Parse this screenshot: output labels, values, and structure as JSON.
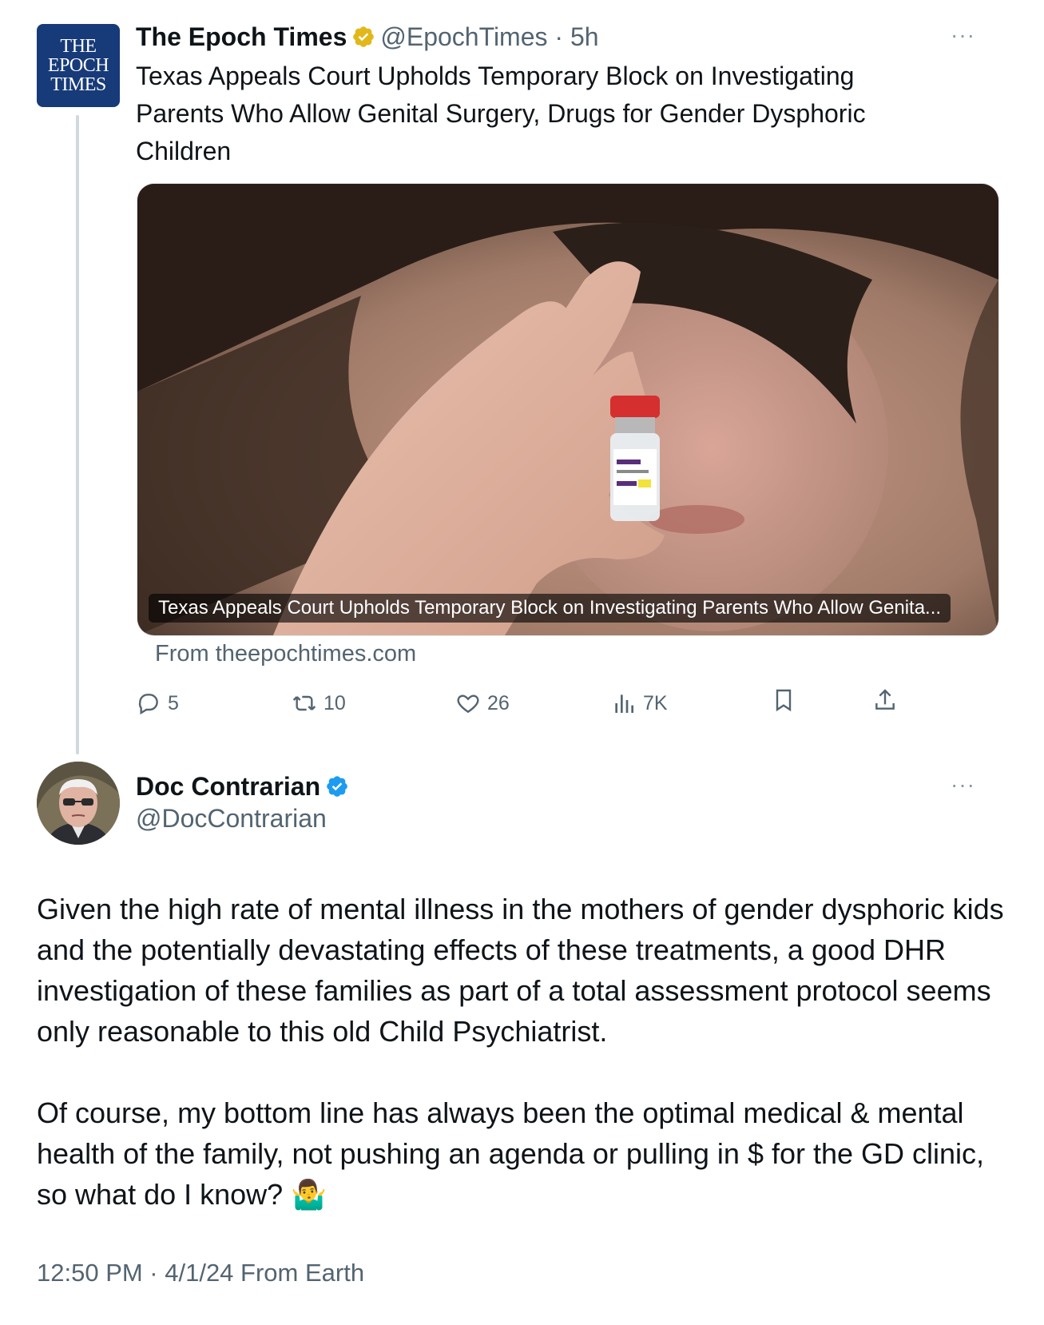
{
  "quoted_tweet": {
    "avatar_text": [
      "THE",
      "EPOCH",
      "TIMES"
    ],
    "author_name": "The Epoch Times",
    "handle_time": "@EpochTimes · 5h",
    "more": "···",
    "headline": "Texas Appeals Court Upholds Temporary Block on Investigating Parents Who Allow Genital Surgery, Drugs for Gender Dysphoric Children",
    "media_caption": "Texas Appeals Court Upholds Temporary Block on Investigating Parents Who Allow Genita...",
    "source": "From theepochtimes.com",
    "stats": {
      "replies": "5",
      "reposts": "10",
      "likes": "26",
      "views": "7K"
    }
  },
  "main_tweet": {
    "author_name": "Doc Contrarian",
    "handle": "@DocContrarian",
    "more": "···",
    "paragraphs": [
      "Given the high rate of mental illness in the mothers of gender dysphoric kids and the potentially devastating effects of these treatments, a good DHR investigation of these families as part of a total assessment protocol seems only reasonable to this old Child Psychiatrist.",
      "Of course, my bottom line has always been the optimal medical & mental health of the family, not pushing an agenda or pulling in $ for the GD clinic, so what do I know? 🤷‍♂️"
    ],
    "timestamp": "12:50 PM · 4/1/24 From Earth"
  },
  "colors": {
    "gold_badge": "#e2b719",
    "blue_badge": "#1d9bf0",
    "muted_text": "#536471",
    "epoch_brand": "#173a78"
  },
  "icons": [
    "verified-gold-icon",
    "verified-blue-icon",
    "reply-icon",
    "repost-icon",
    "like-icon",
    "views-icon",
    "bookmark-icon",
    "share-icon",
    "more-icon"
  ]
}
